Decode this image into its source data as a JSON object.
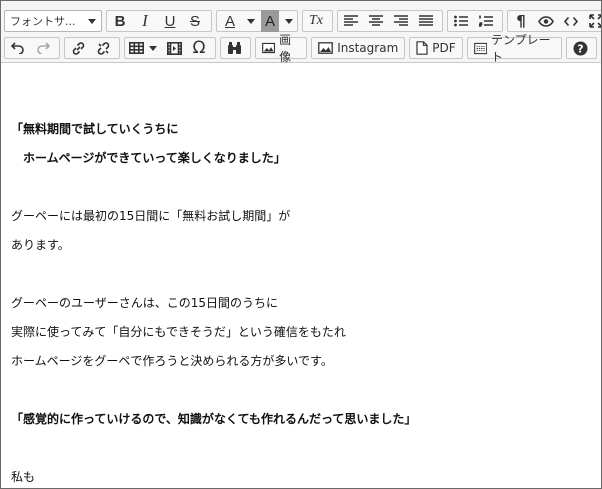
{
  "toolbar": {
    "font_combo": {
      "value": "フォントサ..."
    },
    "buttons_row1": {
      "bold": "B",
      "italic": "I",
      "underline": "U",
      "strike": "S",
      "text_color": "A",
      "bg_color": "A",
      "clear_format": "Tx"
    },
    "buttons_row2": {
      "image_label": "画像",
      "instagram_label": "Instagram",
      "pdf_label": "PDF",
      "template_label": "テンプレート",
      "special_char": "Ω"
    }
  },
  "content": {
    "lines": [
      "「無料期間で試していくうちに",
      "　ホームページができていって楽しくなりました」",
      "グーペーには最初の15日間に「無料お試し期間」が",
      "あります。",
      "グーペーのユーザーさんは、この15日間のうちに",
      "実際に使ってみて「自分にもできそうだ」という確信をもたれ",
      "ホームページをグーペで作ろうと決められる方が多いです。",
      "「感覚的に作っていけるので、知識がなくても作れるんだって思いました」",
      "私も"
    ]
  }
}
